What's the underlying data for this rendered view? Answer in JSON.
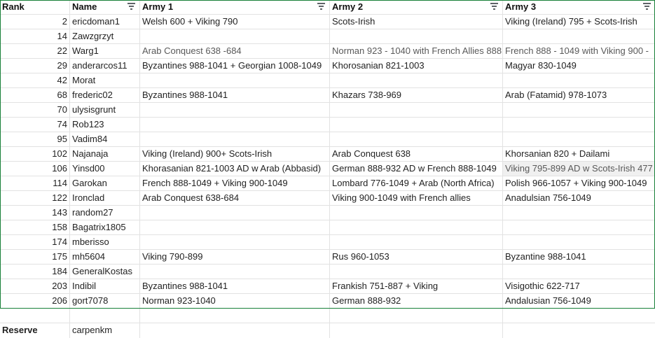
{
  "header": {
    "rank": "Rank",
    "name": "Name",
    "army1": "Army 1",
    "army2": "Army 2",
    "army3": "Army 3"
  },
  "rows": [
    {
      "rank": "2",
      "name": "ericdoman1",
      "army1": "Welsh 600 + Viking 790",
      "army2": "Scots-Irish",
      "army3": "Viking (Ireland) 795 + Scots-Irish"
    },
    {
      "rank": "14",
      "name": "Zawzgrzyt",
      "army1": "",
      "army2": "",
      "army3": ""
    },
    {
      "rank": "22",
      "name": "Warg1",
      "army1": "Arab Conquest 638 -684",
      "army2": "Norman 923 - 1040 with French Allies 888",
      "army3": "French 888 - 1049 with Viking 900 -"
    },
    {
      "rank": "29",
      "name": "anderarcos11",
      "army1": "Byzantines 988-1041 + Georgian 1008-1049",
      "army2": "Khorosanian 821-1003",
      "army3": "Magyar 830-1049"
    },
    {
      "rank": "42",
      "name": "Morat",
      "army1": "",
      "army2": "",
      "army3": ""
    },
    {
      "rank": "68",
      "name": "frederic02",
      "army1": "Byzantines 988-1041",
      "army2": "Khazars 738-969",
      "army3": "Arab (Fatamid) 978-1073"
    },
    {
      "rank": "70",
      "name": "ulysisgrunt",
      "army1": "",
      "army2": "",
      "army3": ""
    },
    {
      "rank": "74",
      "name": "Rob123",
      "army1": "",
      "army2": "",
      "army3": ""
    },
    {
      "rank": "95",
      "name": "Vadim84",
      "army1": "",
      "army2": "",
      "army3": ""
    },
    {
      "rank": "102",
      "name": "Najanaja",
      "army1": "Viking (Ireland) 900+ Scots-Irish",
      "army2": "Arab Conquest 638",
      "army3": "Khorsanian 820 + Dailami"
    },
    {
      "rank": "106",
      "name": "Yinsd00",
      "army1": "Khorasanian 821-1003 AD w Arab (Abbasid)",
      "army2": "German 888-932 AD w French 888-1049",
      "army3": "Viking 795-899 AD w Scots-Irish 477"
    },
    {
      "rank": "114",
      "name": "Garokan",
      "army1": "French 888-1049 + Viking 900-1049",
      "army2": "Lombard 776-1049 + Arab (North Africa)",
      "army3": "Polish 966-1057 + Viking 900-1049"
    },
    {
      "rank": "122",
      "name": "Ironclad",
      "army1": "Arab Conquest 638-684",
      "army2": "Viking 900-1049 with French allies",
      "army3": "Anadulsian 756-1049"
    },
    {
      "rank": "143",
      "name": "random27",
      "army1": "",
      "army2": "",
      "army3": ""
    },
    {
      "rank": "158",
      "name": "Bagatrix1805",
      "army1": "",
      "army2": "",
      "army3": ""
    },
    {
      "rank": "174",
      "name": "mberisso",
      "army1": "",
      "army2": "",
      "army3": ""
    },
    {
      "rank": "175",
      "name": "mh5604",
      "army1": "Viking 790-899",
      "army2": "Rus 960-1053",
      "army3": "Byzantine 988-1041"
    },
    {
      "rank": "184",
      "name": "GeneralKostas",
      "army1": "",
      "army2": "",
      "army3": ""
    },
    {
      "rank": "203",
      "name": "Indibil",
      "army1": "Byzantines 988-1041",
      "army2": "Frankish 751-887 + Viking",
      "army3": "Visigothic 622-717"
    },
    {
      "rank": "206",
      "name": "gort7078",
      "army1": "Norman 923-1040",
      "army2": "German 888-932",
      "army3": "Andalusian 756-1049"
    }
  ],
  "reserve": {
    "label": "Reserve",
    "name": "carpenkm"
  },
  "colors": {
    "table_border": "#188038",
    "grid_line": "#e2e2e2",
    "muted_text": "#595959",
    "selected_cell_bg": "#f0f0f0"
  },
  "icons": {
    "filter": "filter-icon"
  }
}
